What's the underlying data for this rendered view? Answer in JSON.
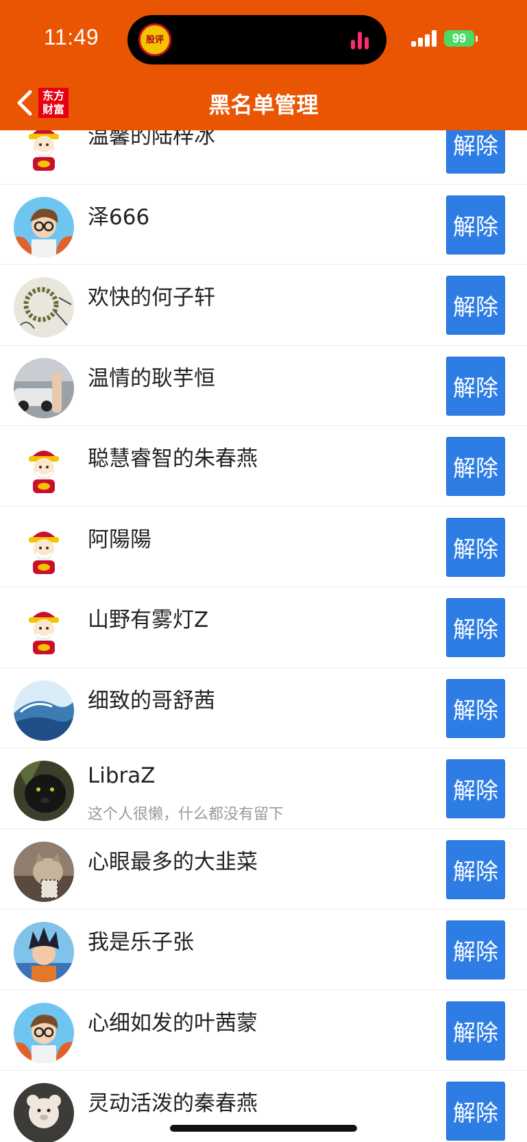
{
  "status_bar": {
    "time": "11:49",
    "island_app": "股评",
    "battery": "99"
  },
  "nav": {
    "title": "黑名单管理",
    "brand_logo": "东方财富",
    "back_icon": "chevron-left-icon"
  },
  "colors": {
    "header_bg": "#ea5504",
    "button_bg": "#2d7de5",
    "name_text": "#222222",
    "bio_text": "#999999"
  },
  "blacklist": {
    "unblock_label": "解除",
    "items": [
      {
        "name": "温馨的陆梓冰",
        "bio": "",
        "avatar": "caishen"
      },
      {
        "name": "泽666",
        "bio": "",
        "avatar": "cartoon-boy"
      },
      {
        "name": "欢快的何子轩",
        "bio": "",
        "avatar": "beads"
      },
      {
        "name": "温情的耿芋恒",
        "bio": "",
        "avatar": "street"
      },
      {
        "name": "聪慧睿智的朱春燕",
        "bio": "",
        "avatar": "caishen"
      },
      {
        "name": "阿陽陽",
        "bio": "",
        "avatar": "caishen"
      },
      {
        "name": "山野有雾灯Z",
        "bio": "",
        "avatar": "caishen"
      },
      {
        "name": "细致的哥舒茜",
        "bio": "",
        "avatar": "wave"
      },
      {
        "name": "LibraZ",
        "bio": "这个人很懒，什么都没有留下",
        "avatar": "panther"
      },
      {
        "name": "心眼最多的大韭菜",
        "bio": "",
        "avatar": "cat"
      },
      {
        "name": "我是乐子张",
        "bio": "",
        "avatar": "anime-boy"
      },
      {
        "name": "心细如发的叶茜蒙",
        "bio": "",
        "avatar": "cartoon-boy"
      },
      {
        "name": "灵动活泼的秦春燕",
        "bio": "",
        "avatar": "teddy-bear"
      }
    ]
  }
}
